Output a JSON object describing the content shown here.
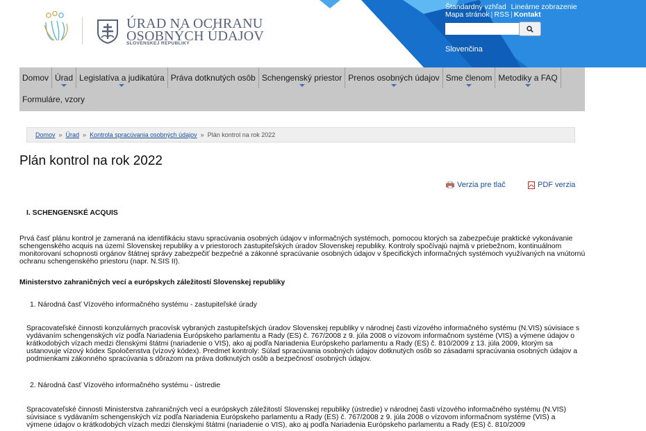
{
  "header": {
    "logo_line1": "ÚRAD NA OCHRANU",
    "logo_line2": "OSOBNÝCH ÚDAJOV",
    "logo_sub": "SLOVENSKEJ REPUBLIKY",
    "links_row1": [
      "Štandardný vzhľad",
      "Lineárne zobrazenie"
    ],
    "links_row2": [
      "Mapa stránok",
      "RSS",
      "Kontakt"
    ],
    "search": {
      "placeholder": "",
      "button_icon": "search-icon"
    },
    "language": "Slovenčina"
  },
  "nav": {
    "row1": [
      {
        "label": "Domov",
        "caret": false
      },
      {
        "label": "Úrad",
        "caret": true
      },
      {
        "label": "Legislatíva a judikatúra",
        "caret": true
      },
      {
        "label": "Práva dotknutých osôb",
        "caret": false
      },
      {
        "label": "Schengenský priestor",
        "caret": true
      },
      {
        "label": "Prenos osobných údajov",
        "caret": true
      },
      {
        "label": "Sme členom",
        "caret": true
      },
      {
        "label": "Metodiky a FAQ",
        "caret": true
      }
    ],
    "row2": [
      {
        "label": "Formuláre, vzory",
        "caret": false
      }
    ]
  },
  "breadcrumb": {
    "items": [
      "Domov",
      "Úrad",
      "Kontrola spracúvania osobných údajov"
    ],
    "current": "Plán kontrol na rok 2022"
  },
  "page_title": "Plán kontrol na rok 2022",
  "tools": {
    "print": "Verzia pre tlač",
    "pdf": "PDF verzia"
  },
  "content": {
    "section_heading": "I. SCHENGENSKÉ ACQUIS",
    "intro_paragraph": "Prvá časť plánu kontrol je  zameraná  na identifikáciu stavu spracúvania osobných údajov v informačných systémoch, pomocou ktorých sa zabezpečuje praktické vykonávanie schengenského acquis na území Slovenskej republiky a v priestoroch zastupiteľských úradov Slovenskej republiky. Kontroly spočívajú najmä v priebežnom, kontinuálnom monitorovaní schopnosti orgánov štátnej správy zabezpečiť bezpečné a zákonné spracúvanie osobných údajov v špecifických informačných systémoch využívaných na vnútornú ochranu schengenského priestoru (napr. N.SIS II).",
    "ministry_heading": "Ministerstvo zahraničných vecí a európskych záležitostí Slovenskej republiky",
    "item1_title": "1. Národná časť Vízového informačného systému - zastupiteľské úrady",
    "item1_text": "Spracovateľské činnosti konzulárnych pracovísk vybraných zastupiteľských úradov Slovenskej republiky v národnej časti vízového informačného systému (N.VIS) súvisiace s vydávaním schengenských víz podľa Nariadenia Európskeho parlamentu a Rady (ES) č. 767/2008 z 9. júla 2008 o vízovom informačnom systéme (VIS) a výmene údajov o krátkodobých vízach medzi členskými štátmi (nariadenie o VIS), ako aj podľa Nariadenia Európskeho parlamentu a Rady (ES) č. 810/2009 z 13. júla 2009, ktorým sa ustanovuje vízový kódex Spoločenstva (vízový kódex). Predmet kontroly: Súlad spracúvania osobných údajov dotknutých osôb so zásadami spracúvania osobných údajov a podmienkami zákonného spracúvania s dôrazom na práva dotknutých osôb a bezpečnosť osobných údajov.",
    "item2_title": "2. Národná časť Vízového informačného systému - ústredie",
    "item2_text": "Spracovateľské činnosti Ministerstva zahraničných vecí a európskych záležitostí Slovenskej republiky (ústredie) v národnej časti vízového informačného systému (N.VIS) súvisiace s vydávaním schengenských víz podľa Nariadenia Európskeho parlamentu a Rady (ES) č. 767/2008 z 9. júla 2008 o vízovom informačnom systéme (VIS) a výmene údajov o krátkodobých vízach medzi členskými štátmi (nariadenie o VIS), ako aj podľa Nariadenia Európskeho parlamentu a Rady (ES) č. 810/2009"
  },
  "colors": {
    "nav_bg": "#c7c7c7",
    "header_blue": "#1e7fd8",
    "link": "#1a4f9c",
    "caret": "#3f6fb5"
  }
}
